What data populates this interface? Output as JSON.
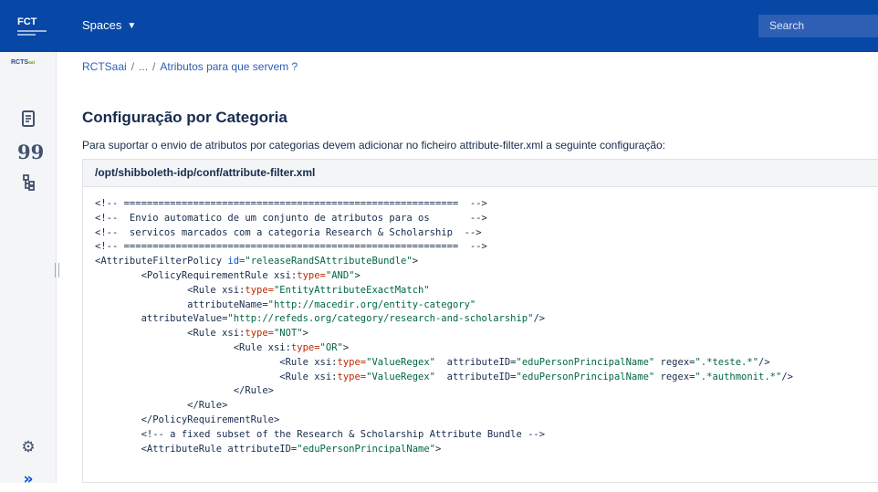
{
  "topbar": {
    "logo": "FCT",
    "spaces_label": "Spaces",
    "chevron": "chevron-down-icon",
    "search_placeholder": "Search"
  },
  "sidebar": {
    "space_logo": "RCTS",
    "space_logo_suffix": "aai",
    "icons": [
      "page-icon",
      "quote-icon",
      "page-tree-icon",
      "settings-icon",
      "expand-icon"
    ]
  },
  "breadcrumb": {
    "root": "RCTSaai",
    "ellipsis": "...",
    "current": "Atributos para que servem ?"
  },
  "page": {
    "heading": "Configuração por Categoria",
    "intro": "Para suportar o envio de atributos por categorias devem adicionar no ficheiro attribute-filter.xml a seguinte configuração:"
  },
  "code": {
    "title": "/opt/shibboleth-idp/conf/attribute-filter.xml",
    "lines": [
      [
        {
          "t": "<!-- ==========================================================  -->"
        }
      ],
      [
        {
          "t": "<!--  Envio automatico de um conjunto de atributos para os       -->"
        }
      ],
      [
        {
          "t": "<!--  servicos marcados com a categoria Research & Scholarship  -->"
        }
      ],
      [
        {
          "t": "<!-- ==========================================================  -->"
        }
      ],
      [
        {
          "t": "<AttributeFilterPolicy "
        },
        {
          "t": "id=",
          "c": "tok-attr"
        },
        {
          "t": "\"releaseRandSAttributeBundle\"",
          "c": "tok-str"
        },
        {
          "t": ">"
        }
      ],
      [
        {
          "t": "        <PolicyRequirementRule xsi:"
        },
        {
          "t": "type=",
          "c": "tok-kw"
        },
        {
          "t": "\"AND\"",
          "c": "tok-str"
        },
        {
          "t": ">"
        }
      ],
      [
        {
          "t": "                <Rule xsi:"
        },
        {
          "t": "type=",
          "c": "tok-kw"
        },
        {
          "t": "\"EntityAttributeExactMatch\"",
          "c": "tok-str"
        }
      ],
      [
        {
          "t": "                attributeName="
        },
        {
          "t": "\"http://macedir.org/entity-category\"",
          "c": "tok-str"
        }
      ],
      [
        {
          "t": "        attributeValue="
        },
        {
          "t": "\"http://refeds.org/category/research-and-scholarship\"",
          "c": "tok-str"
        },
        {
          "t": "/>"
        }
      ],
      [
        {
          "t": "                <Rule xsi:"
        },
        {
          "t": "type=",
          "c": "tok-kw"
        },
        {
          "t": "\"NOT\"",
          "c": "tok-str"
        },
        {
          "t": ">"
        }
      ],
      [
        {
          "t": "                        <Rule xsi:"
        },
        {
          "t": "type=",
          "c": "tok-kw"
        },
        {
          "t": "\"OR\"",
          "c": "tok-str"
        },
        {
          "t": ">"
        }
      ],
      [
        {
          "t": "                                <Rule xsi:"
        },
        {
          "t": "type=",
          "c": "tok-kw"
        },
        {
          "t": "\"ValueRegex\"",
          "c": "tok-str"
        },
        {
          "t": "  attributeID="
        },
        {
          "t": "\"eduPersonPrincipalName\"",
          "c": "tok-str"
        },
        {
          "t": " regex="
        },
        {
          "t": "\".*teste.*\"",
          "c": "tok-str"
        },
        {
          "t": "/>"
        }
      ],
      [
        {
          "t": "                                <Rule xsi:"
        },
        {
          "t": "type=",
          "c": "tok-kw"
        },
        {
          "t": "\"ValueRegex\"",
          "c": "tok-str"
        },
        {
          "t": "  attributeID="
        },
        {
          "t": "\"eduPersonPrincipalName\"",
          "c": "tok-str"
        },
        {
          "t": " regex="
        },
        {
          "t": "\".*authmonit.*\"",
          "c": "tok-str"
        },
        {
          "t": "/>"
        }
      ],
      [
        {
          "t": "                        </Rule>"
        }
      ],
      [
        {
          "t": "                </Rule>"
        }
      ],
      [
        {
          "t": "        </PolicyRequirementRule>"
        }
      ],
      [
        {
          "t": "        <!-- a fixed subset of the Research & Scholarship Attribute Bundle -->"
        }
      ],
      [
        {
          "t": "        <AttributeRule attributeID="
        },
        {
          "t": "\"eduPersonPrincipalName\"",
          "c": "tok-str"
        },
        {
          "t": ">"
        }
      ]
    ]
  }
}
